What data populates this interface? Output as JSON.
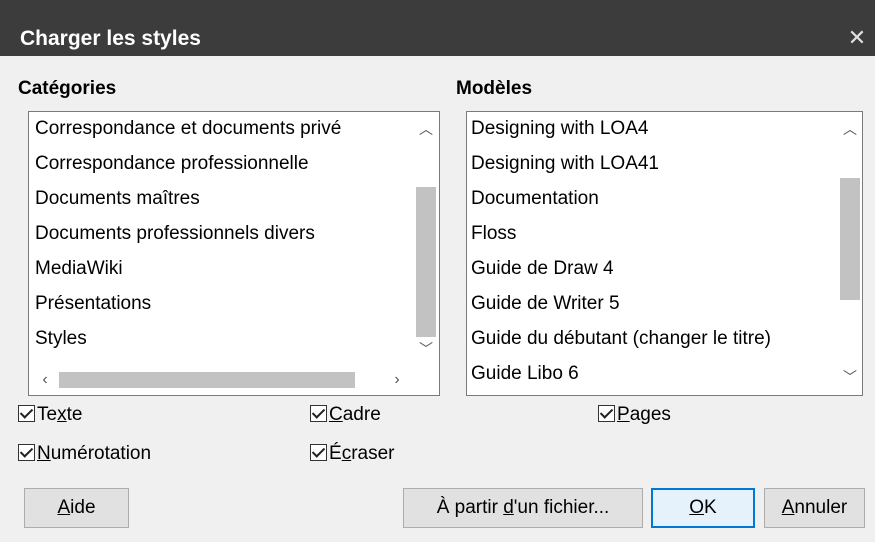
{
  "dialog": {
    "title": "Charger les styles",
    "close_glyph": "✕"
  },
  "categories": {
    "heading": "Catégories",
    "items": [
      "Correspondance et documents privé",
      "Correspondance professionnelle",
      "Documents maîtres",
      "Documents professionnels divers",
      "MediaWiki",
      "Présentations",
      "Styles"
    ]
  },
  "templates": {
    "heading": "Modèles",
    "items": [
      "Designing with LOA4",
      "Designing with LOA41",
      "Documentation",
      "Floss",
      "Guide de Draw 4",
      "Guide de Writer 5",
      "Guide du débutant (changer le titre)",
      "Guide Libo 6"
    ]
  },
  "options": {
    "texte": {
      "pre": "Te",
      "key": "x",
      "post": "te",
      "checked": true
    },
    "cadre": {
      "pre": "",
      "key": "C",
      "post": "adre",
      "checked": true
    },
    "pages": {
      "pre": "",
      "key": "P",
      "post": "ages",
      "checked": true
    },
    "numerotation": {
      "pre": "",
      "key": "N",
      "post": "umérotation",
      "checked": true
    },
    "ecraser": {
      "pre": "É",
      "key": "c",
      "post": "raser",
      "checked": true
    }
  },
  "buttons": {
    "aide": {
      "pre": "",
      "key": "A",
      "post": "ide"
    },
    "from_file": {
      "pre": "À partir ",
      "key": "d",
      "post": "'un fichier..."
    },
    "ok": {
      "pre": "",
      "key": "O",
      "post": "K"
    },
    "annuler": {
      "pre": "",
      "key": "A",
      "post": "nnuler"
    }
  },
  "colors": {
    "titlebar": "#3c3c3c",
    "accent": "#0078d7",
    "background": "#f0f0f0"
  }
}
